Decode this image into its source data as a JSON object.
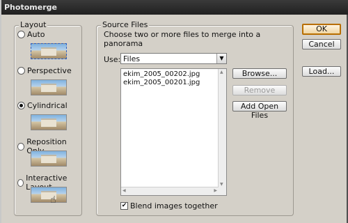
{
  "window": {
    "title": "Photomerge"
  },
  "layout_group": {
    "label": "Layout",
    "options": [
      {
        "label": "Auto",
        "selected": false
      },
      {
        "label": "Perspective",
        "selected": false
      },
      {
        "label": "Cylindrical",
        "selected": true
      },
      {
        "label": "Reposition Only",
        "selected": false
      },
      {
        "label": "Interactive Layout",
        "selected": false
      }
    ]
  },
  "source_files": {
    "label": "Source Files",
    "instruction": "Choose two or more files to merge into a panorama",
    "use_label": "Use:",
    "use_value": "Files",
    "files": [
      "ekim_2005_00202.jpg",
      "ekim_2005_00201.jpg"
    ],
    "browse_label": "Browse...",
    "remove_label": "Remove",
    "add_open_label": "Add Open Files",
    "blend_label": "Blend images together",
    "blend_checked": true
  },
  "buttons": {
    "ok": "OK",
    "cancel": "Cancel",
    "load": "Load..."
  }
}
